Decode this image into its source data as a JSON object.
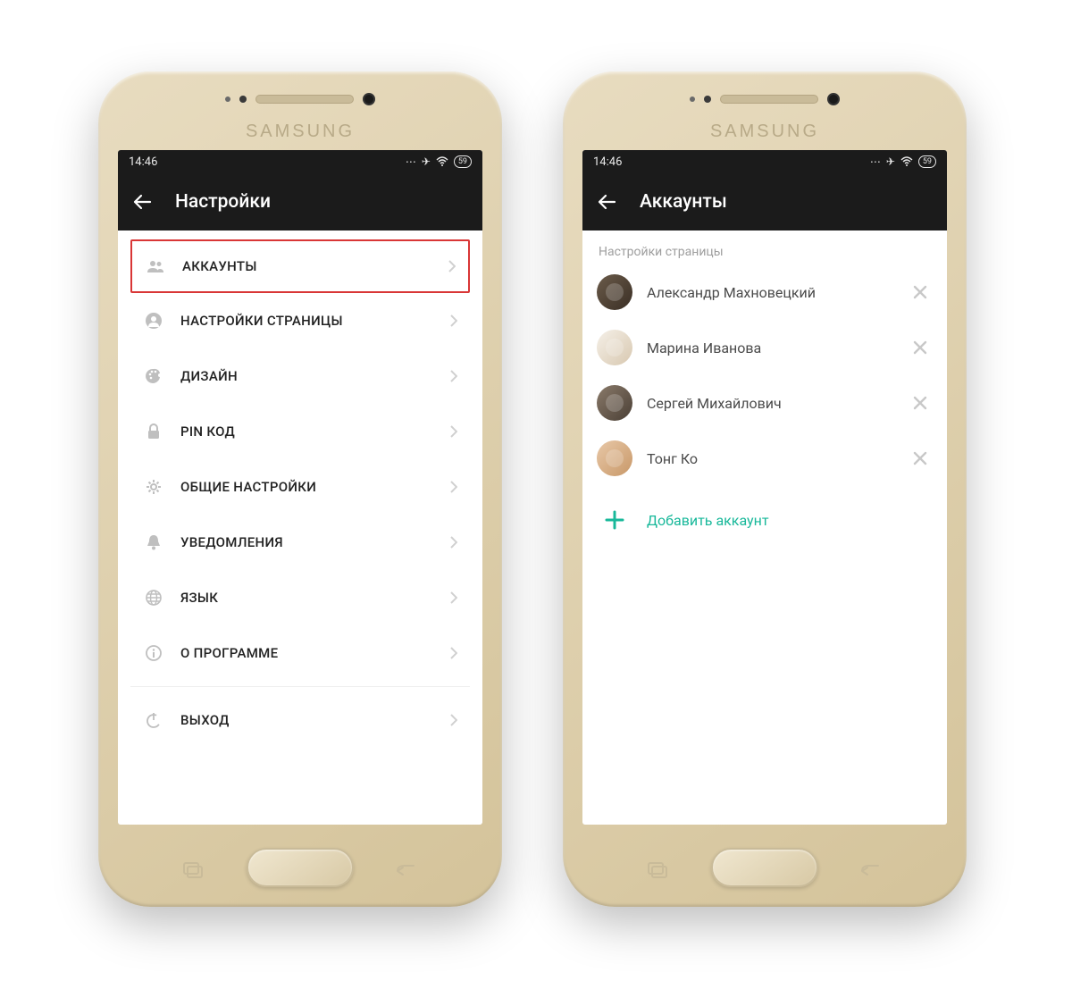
{
  "brand": "SAMSUNG",
  "statusbar": {
    "time": "14:46",
    "battery": "59"
  },
  "left": {
    "title": "Настройки",
    "items": [
      {
        "icon": "users-icon",
        "label": "АККАУНТЫ",
        "highlighted": true
      },
      {
        "icon": "person-icon",
        "label": "НАСТРОЙКИ СТРАНИЦЫ",
        "highlighted": false
      },
      {
        "icon": "palette-icon",
        "label": "ДИЗАЙН",
        "highlighted": false
      },
      {
        "icon": "lock-icon",
        "label": "PIN КОД",
        "highlighted": false
      },
      {
        "icon": "gear-icon",
        "label": "ОБЩИЕ НАСТРОЙКИ",
        "highlighted": false
      },
      {
        "icon": "bell-icon",
        "label": "УВЕДОМЛЕНИЯ",
        "highlighted": false
      },
      {
        "icon": "globe-icon",
        "label": "ЯЗЫК",
        "highlighted": false
      },
      {
        "icon": "info-icon",
        "label": "О ПРОГРАММЕ",
        "highlighted": false
      }
    ],
    "exit": {
      "icon": "power-icon",
      "label": "ВЫХОД"
    }
  },
  "right": {
    "title": "Аккаунты",
    "section_header": "Настройки страницы",
    "accounts": [
      {
        "name": "Александр Махновецкий"
      },
      {
        "name": "Марина Иванова"
      },
      {
        "name": "Сергей Михайлович"
      },
      {
        "name": "Тонг Ко"
      }
    ],
    "add_label": "Добавить аккаунт"
  },
  "colors": {
    "accent": "#18b89a",
    "highlight_border": "#d93636",
    "appbar_bg": "#1b1b1b"
  }
}
